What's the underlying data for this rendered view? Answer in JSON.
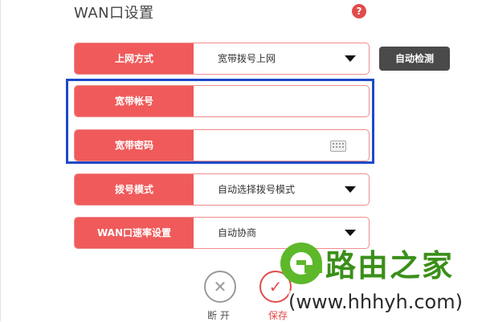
{
  "page": {
    "title": "WAN口设置",
    "help_glyph": "?"
  },
  "form": {
    "fields": [
      {
        "label": "上网方式",
        "value": "宽带拨号上网",
        "control": "dropdown"
      },
      {
        "label": "宽带帐号",
        "value": "",
        "control": "text"
      },
      {
        "label": "宽带密码",
        "value": "",
        "control": "password"
      },
      {
        "label": "拨号模式",
        "value": "自动选择拨号模式",
        "control": "dropdown"
      },
      {
        "label": "WAN口速率设置",
        "value": "自动协商",
        "control": "dropdown"
      }
    ],
    "detect_button_label": "自动检测"
  },
  "actions": {
    "disconnect_label": "断 开",
    "disconnect_glyph": "✕",
    "save_label": "保存",
    "save_glyph": "✓"
  },
  "watermark": {
    "brand_text": "路由之家",
    "url_text": "(www.hhhyh.com)"
  },
  "colors": {
    "label_bg": "#f05a5a",
    "field_border": "#f08c8c",
    "highlight": "#1d49c9",
    "detect_button_bg": "#4a4a4a",
    "watermark_green": "#5db82a"
  },
  "icons": {
    "help": "question-circle-icon",
    "dropdown": "caret-down-icon",
    "keyboard": "keyboard-icon",
    "disconnect": "close-circle-icon",
    "save": "check-circle-icon"
  }
}
